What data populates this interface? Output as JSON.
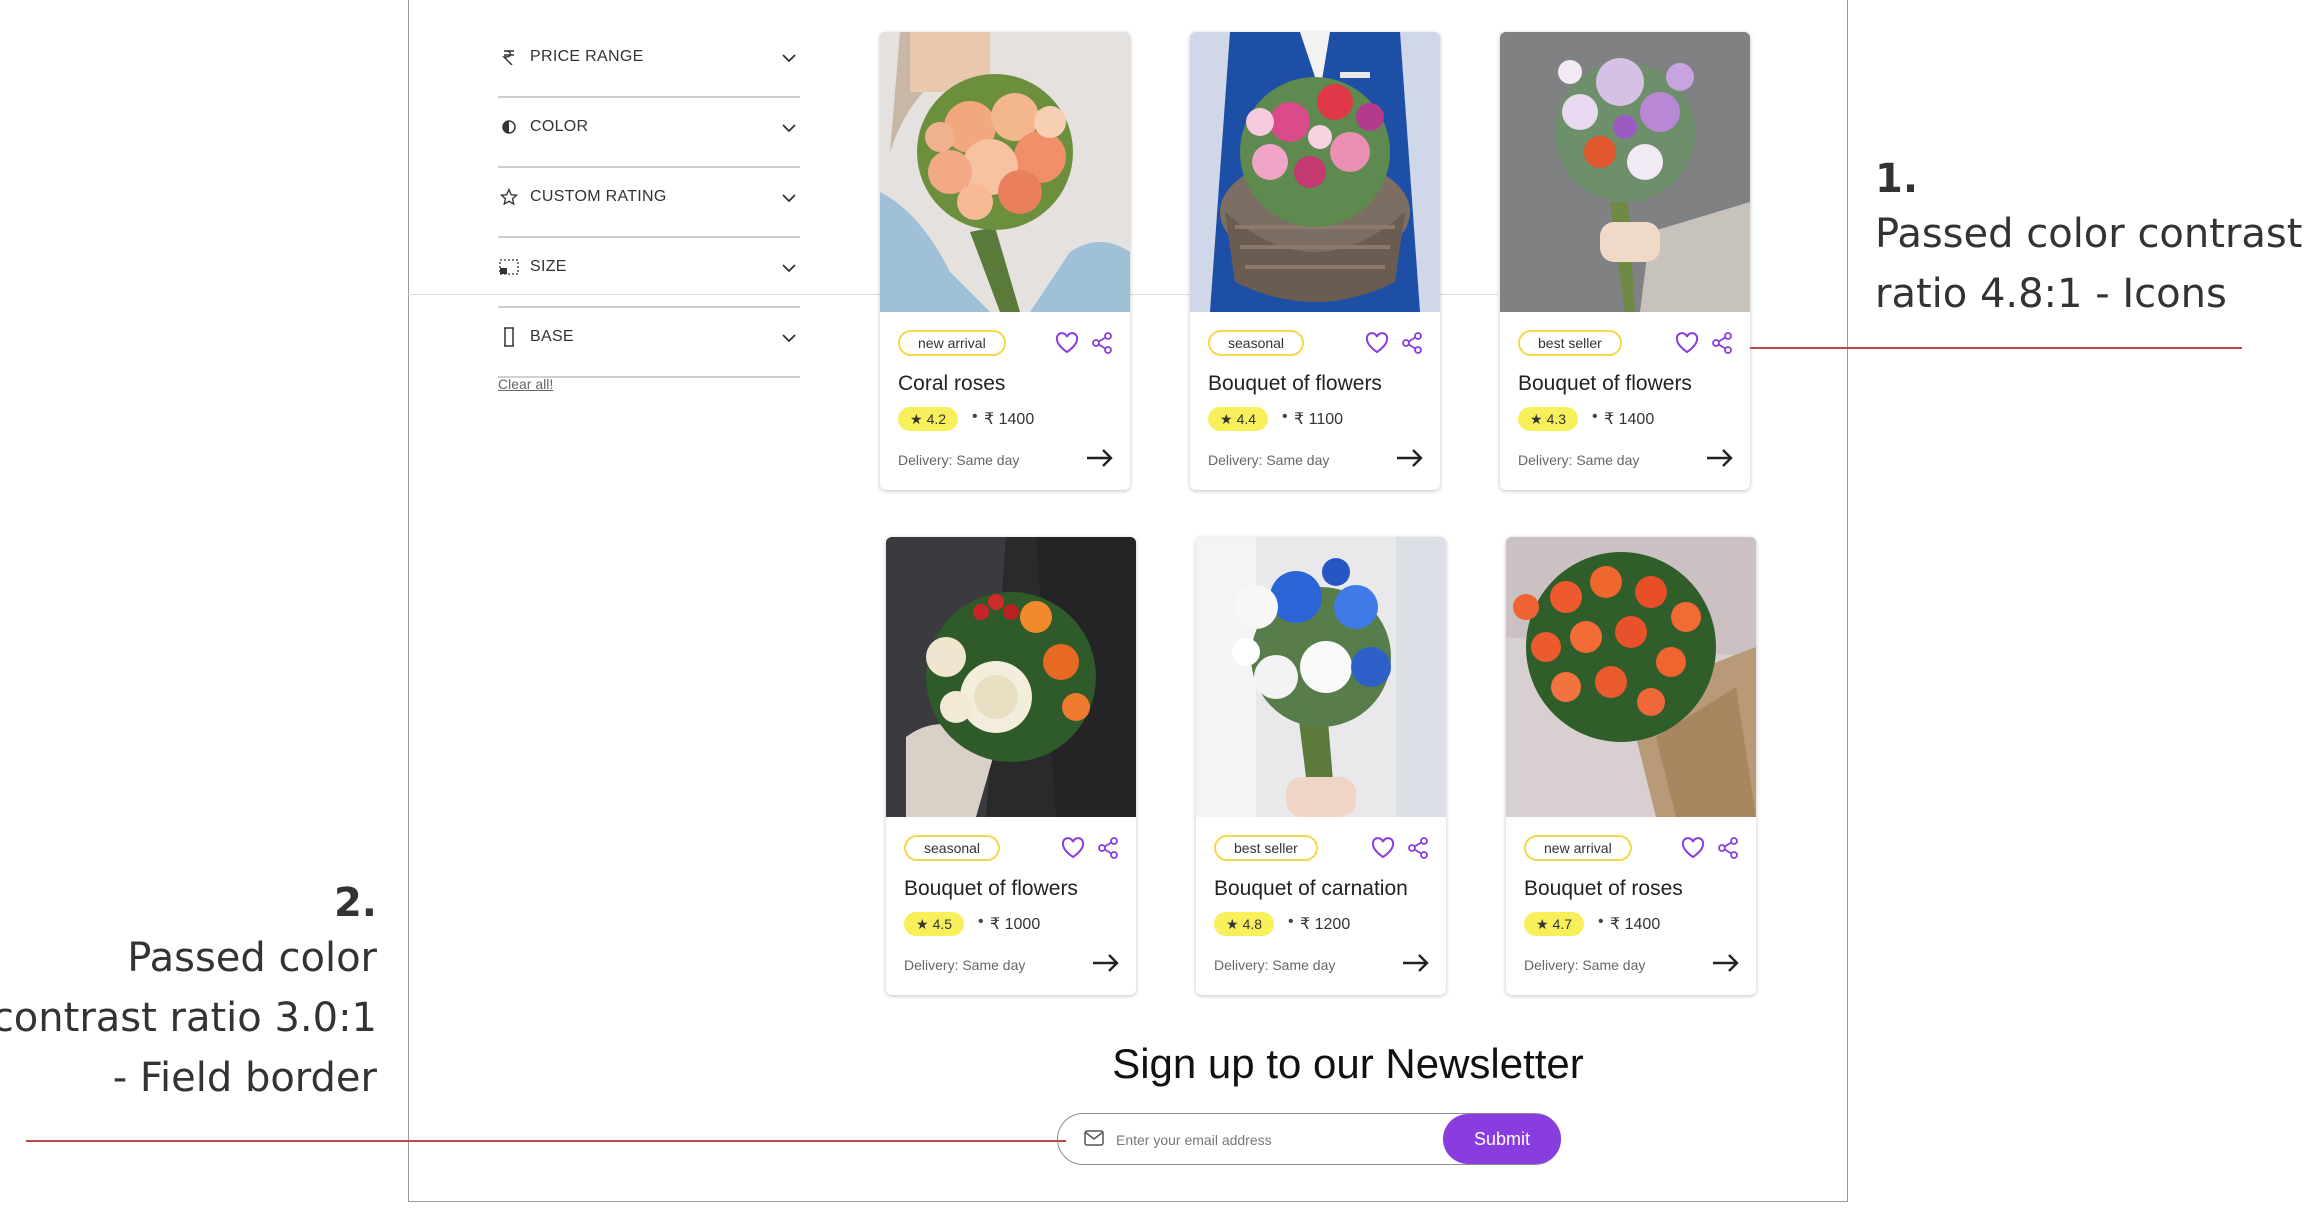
{
  "filters": [
    {
      "label": "PRICE RANGE",
      "icon": "rupee-icon"
    },
    {
      "label": "COLOR",
      "icon": "color-contrast-icon"
    },
    {
      "label": "CUSTOM RATING",
      "icon": "star-outline-icon"
    },
    {
      "label": "SIZE",
      "icon": "size-frame-icon"
    },
    {
      "label": "BASE",
      "icon": "vase-base-icon"
    }
  ],
  "clear_all": "Clear all!",
  "products": [
    {
      "tag": "new arrival",
      "name": "Coral roses",
      "rating": "4.2",
      "price": "₹ 1400",
      "delivery": "Delivery: Same day"
    },
    {
      "tag": "seasonal",
      "name": "Bouquet of flowers",
      "rating": "4.4",
      "price": "₹ 1100",
      "delivery": "Delivery: Same day"
    },
    {
      "tag": "best seller",
      "name": "Bouquet of flowers",
      "rating": "4.3",
      "price": "₹ 1400",
      "delivery": "Delivery: Same day"
    },
    {
      "tag": "seasonal",
      "name": "Bouquet of flowers",
      "rating": "4.5",
      "price": "₹ 1000",
      "delivery": "Delivery: Same day"
    },
    {
      "tag": "best seller",
      "name": "Bouquet of carnation",
      "rating": "4.8",
      "price": "₹ 1200",
      "delivery": "Delivery: Same day"
    },
    {
      "tag": "new arrival",
      "name": "Bouquet of roses",
      "rating": "4.7",
      "price": "₹ 1400",
      "delivery": "Delivery: Same day"
    }
  ],
  "newsletter": {
    "title": "Sign up to our Newsletter",
    "placeholder": "Enter your email address",
    "submit_label": "Submit"
  },
  "annotations": {
    "first": {
      "number": "1.",
      "text": "Passed color contrast ratio 4.8:1 - Icons"
    },
    "second": {
      "number": "2.",
      "text": "Passed color contrast ratio 3.0:1 - Field border"
    }
  },
  "colors": {
    "accent": "#8a3ddf",
    "tag_border": "#f4d94b",
    "rating_bg": "#f7f05a",
    "annotation_line": "#b84a4a"
  }
}
